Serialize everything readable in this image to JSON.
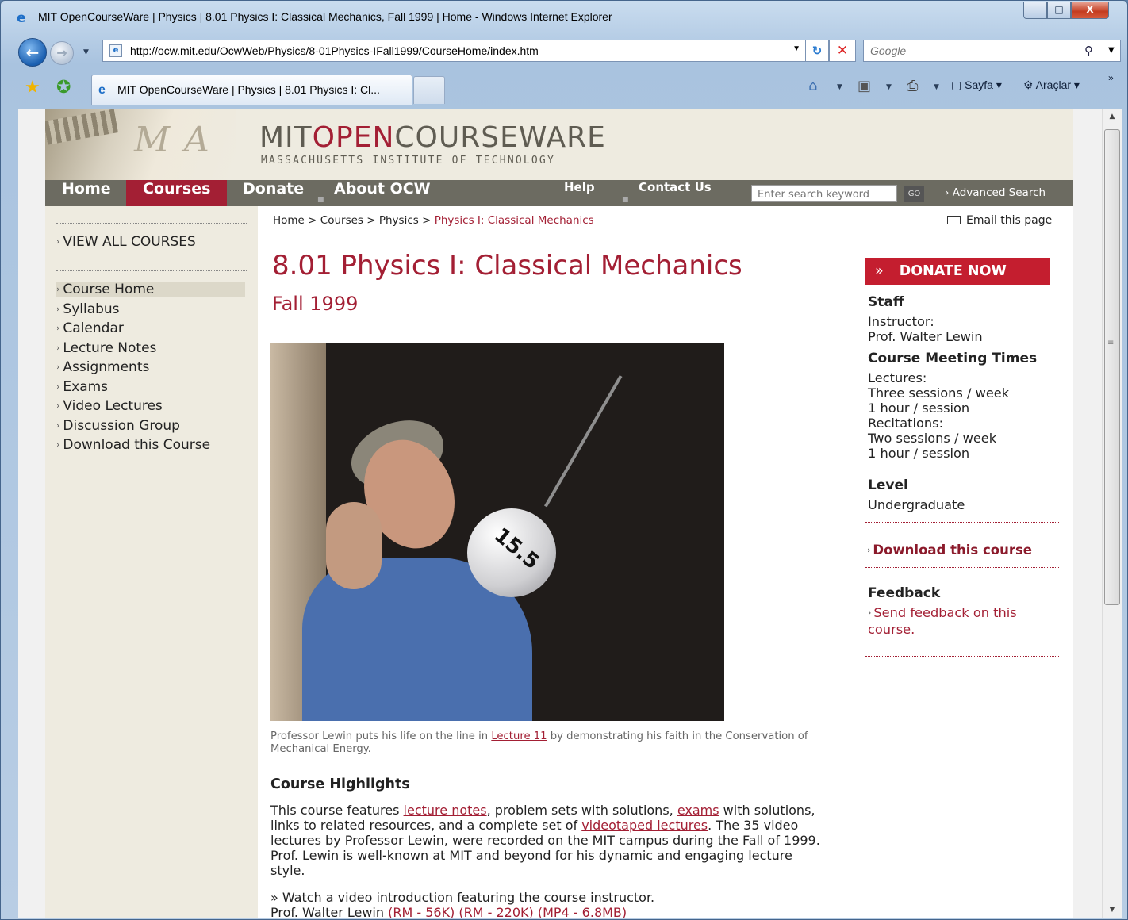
{
  "window": {
    "title": "MIT OpenCourseWare | Physics | 8.01 Physics I: Classical Mechanics, Fall 1999 | Home - Windows Internet Explorer",
    "min": "–",
    "max": "□",
    "close": "X"
  },
  "browser": {
    "url": "http://ocw.mit.edu/OcwWeb/Physics/8-01Physics-IFall1999/CourseHome/index.htm",
    "search_placeholder": "Google",
    "tab_title": "MIT OpenCourseWare | Physics | 8.01 Physics I: Cl...",
    "toolbar": {
      "page_label": "Sayfa",
      "tools_label": "Araçlar",
      "more": "»"
    }
  },
  "site": {
    "logo_prefix": "MIT",
    "logo_open": "OPEN",
    "logo_suffix": "COURSEWARE",
    "logo_sub": "MASSACHUSETTS INSTITUTE OF TECHNOLOGY",
    "nav": {
      "home": "Home",
      "courses": "Courses",
      "donate": "Donate",
      "about": "About OCW",
      "help": "Help",
      "contact": "Contact Us",
      "search_placeholder": "Enter search keyword",
      "go": "GO",
      "advanced": "Advanced Search"
    }
  },
  "sidebar": {
    "view_all": "VIEW ALL COURSES",
    "items": [
      {
        "label": "Course Home"
      },
      {
        "label": "Syllabus"
      },
      {
        "label": "Calendar"
      },
      {
        "label": "Lecture Notes"
      },
      {
        "label": "Assignments"
      },
      {
        "label": "Exams"
      },
      {
        "label": "Video Lectures"
      },
      {
        "label": "Discussion Group"
      },
      {
        "label": "Download this Course"
      }
    ]
  },
  "breadcrumb": {
    "home": "Home",
    "courses": "Courses",
    "physics": "Physics",
    "current": "Physics I: Classical Mechanics",
    "sep": ">"
  },
  "email_page": "Email this page",
  "course": {
    "title": "8.01 Physics I: Classical Mechanics",
    "term": "Fall 1999",
    "ball_label": "15.5",
    "caption_pre": "Professor Lewin puts his life on the line in ",
    "caption_link": "Lecture 11",
    "caption_post": " by demonstrating his faith in the Conservation of Mechanical Energy.",
    "highlights_title": "Course Highlights",
    "hl_1": "This course features ",
    "hl_link1": "lecture notes",
    "hl_2": ", problem sets with solutions, ",
    "hl_link2": "exams",
    "hl_3": " with solutions, links to related resources, and a complete set of ",
    "hl_link3": "videotaped lectures",
    "hl_4": ". The 35 video lectures by Professor Lewin, were recorded on the MIT campus during the Fall of 1999. Prof. Lewin is well-known at MIT and beyond for his dynamic and engaging lecture style.",
    "watch": "» Watch a video introduction featuring the course instructor.",
    "watch2_pre": "Prof. Walter Lewin ",
    "watch2_links": "(RM - 56K) (RM - 220K) (MP4 - 6.8MB)"
  },
  "right": {
    "donate": "DONATE NOW",
    "donate_chev": "»",
    "staff_label": "Staff",
    "instructor_role": "Instructor:",
    "instructor_name": "Prof. Walter Lewin",
    "meeting_label": "Course Meeting Times",
    "lectures_label": "Lectures:",
    "lectures_sessions": "Three sessions / week",
    "lectures_hours": "1 hour / session",
    "recitations_label": "Recitations:",
    "recitations_sessions": "Two sessions / week",
    "recitations_hours": "1 hour / session",
    "level_label": "Level",
    "level_value": "Undergraduate",
    "download": "Download this course",
    "feedback_label": "Feedback",
    "feedback_link": "Send feedback on this course."
  }
}
